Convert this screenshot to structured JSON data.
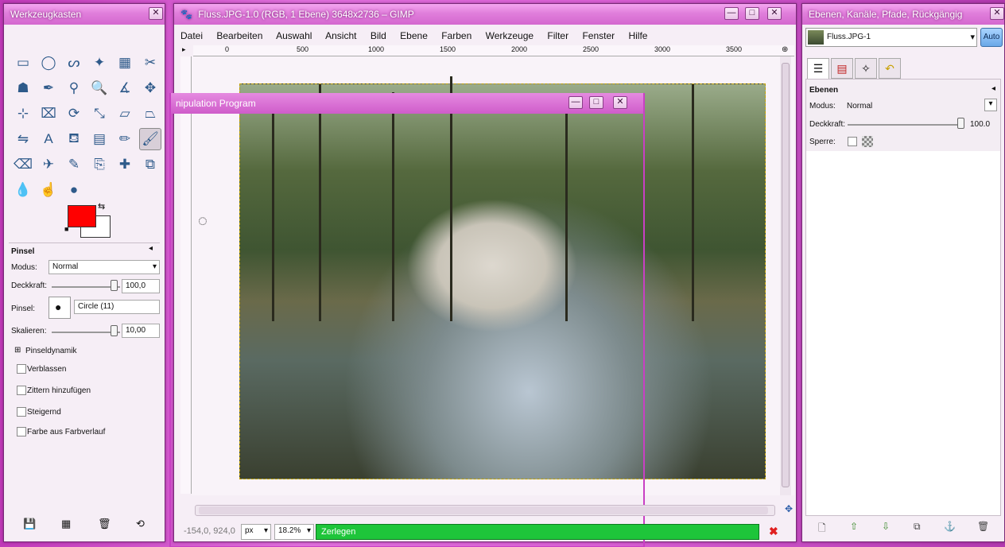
{
  "toolbox": {
    "title": "Werkzeugkasten",
    "tools": [
      {
        "name": "rect-select-icon",
        "glyph": "▭"
      },
      {
        "name": "ellipse-select-icon",
        "glyph": "◯"
      },
      {
        "name": "free-select-icon",
        "glyph": "ᔕ"
      },
      {
        "name": "fuzzy-select-icon",
        "glyph": "✦"
      },
      {
        "name": "color-select-icon",
        "glyph": "▦"
      },
      {
        "name": "scissors-icon",
        "glyph": "✂"
      },
      {
        "name": "foreground-select-icon",
        "glyph": "☗"
      },
      {
        "name": "paths-icon",
        "glyph": "✒"
      },
      {
        "name": "color-picker-icon",
        "glyph": "⚲"
      },
      {
        "name": "zoom-icon",
        "glyph": "🔍"
      },
      {
        "name": "measure-icon",
        "glyph": "∡"
      },
      {
        "name": "move-icon",
        "glyph": "✥"
      },
      {
        "name": "align-icon",
        "glyph": "⊹"
      },
      {
        "name": "crop-icon",
        "glyph": "⌧"
      },
      {
        "name": "rotate-icon",
        "glyph": "⟳"
      },
      {
        "name": "scale-icon",
        "glyph": "⤡"
      },
      {
        "name": "shear-icon",
        "glyph": "▱"
      },
      {
        "name": "perspective-icon",
        "glyph": "⏢"
      },
      {
        "name": "flip-icon",
        "glyph": "⇋"
      },
      {
        "name": "text-icon",
        "glyph": "A"
      },
      {
        "name": "bucket-fill-icon",
        "glyph": "⛾"
      },
      {
        "name": "blend-icon",
        "glyph": "▤"
      },
      {
        "name": "pencil-icon",
        "glyph": "✏"
      },
      {
        "name": "paintbrush-icon",
        "glyph": "🖌"
      },
      {
        "name": "eraser-icon",
        "glyph": "⌫"
      },
      {
        "name": "airbrush-icon",
        "glyph": "✈"
      },
      {
        "name": "ink-icon",
        "glyph": "✎"
      },
      {
        "name": "clone-icon",
        "glyph": "⎘"
      },
      {
        "name": "heal-icon",
        "glyph": "✚"
      },
      {
        "name": "perspective-clone-icon",
        "glyph": "⧉"
      },
      {
        "name": "blur-icon",
        "glyph": "💧"
      },
      {
        "name": "smudge-icon",
        "glyph": "☝"
      },
      {
        "name": "dodge-burn-icon",
        "glyph": "●"
      }
    ],
    "active_tool": 23,
    "colors": {
      "foreground": "#ff0000",
      "background": "#ffffff"
    },
    "options": {
      "section": "Pinsel",
      "mode_label": "Modus:",
      "mode_value": "Normal",
      "opacity_label": "Deckkraft:",
      "opacity_value": "100,0",
      "brush_label": "Pinsel:",
      "brush_value": "Circle (11)",
      "scale_label": "Skalieren:",
      "scale_value": "10,00",
      "dynamics": "Pinseldynamik",
      "checks": [
        "Verblassen",
        "Zittern hinzufügen",
        "Steigernd",
        "Farbe aus Farbverlauf"
      ]
    }
  },
  "main": {
    "title": "Fluss.JPG-1.0 (RGB, 1 Ebene) 3648x2736 – GIMP",
    "menu": [
      "Datei",
      "Bearbeiten",
      "Auswahl",
      "Ansicht",
      "Bild",
      "Ebene",
      "Farben",
      "Werkzeuge",
      "Filter",
      "Fenster",
      "Hilfe"
    ],
    "ruler_ticks": [
      "0",
      "500",
      "1000",
      "1500",
      "2000",
      "2500",
      "3000",
      "3500"
    ],
    "background_window_title": "nipulation Program",
    "status": {
      "coords": "-154,0, 924,0",
      "unit": "px",
      "zoom": "18.2%",
      "progress_text": "Zerlegen"
    }
  },
  "layers": {
    "title": "Ebenen, Kanäle, Pfade, Rückgängig",
    "image_name": "Fluss.JPG-1",
    "auto_label": "Auto",
    "panel_title": "Ebenen",
    "mode_label": "Modus:",
    "mode_value": "Normal",
    "opacity_label": "Deckkraft:",
    "opacity_value": "100.0",
    "lock_label": "Sperre:"
  }
}
